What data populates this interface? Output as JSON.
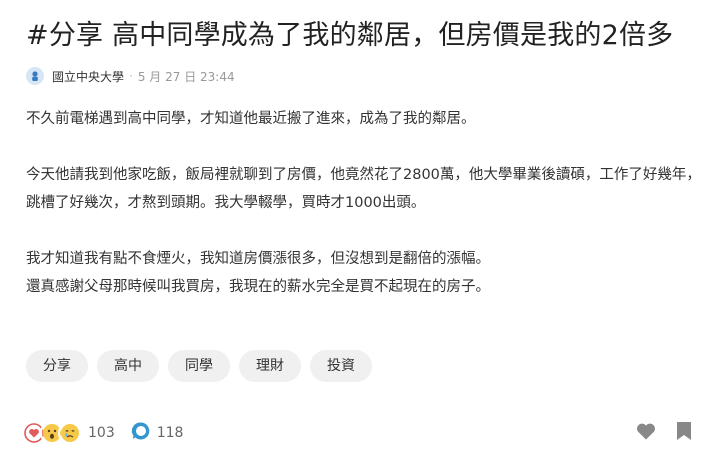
{
  "post": {
    "title": "#分享 高中同學成為了我的鄰居，但房價是我的2倍多",
    "author": "國立中央大學",
    "date": "5 月 27 日 23:44",
    "separator": "·",
    "paragraphs": [
      "不久前電梯遇到高中同學，才知道他最近搬了進來，成為了我的鄰居。",
      "今天他請我到他家吃飯，飯局裡就聊到了房價，他竟然花了2800萬，他大學畢業後讀碩，工作了好幾年，跳槽了好幾次，才熬到頭期。我大學輟學，買時才1000出頭。",
      "我才知道我有點不食煙火，我知道房價漲很多，但沒想到是翻倍的漲幅。",
      "還真感謝父母那時候叫我買房，我現在的薪水完全是買不起現在的房子。"
    ],
    "tags": [
      "分享",
      "高中",
      "同學",
      "理財",
      "投資"
    ]
  },
  "footer": {
    "reaction_count": "103",
    "comment_count": "118",
    "reaction_icons": [
      "heart-icon",
      "surprised-face-icon",
      "crying-face-icon"
    ]
  },
  "colors": {
    "heart": "#e05a5a",
    "surprised": "#f7c948",
    "comment": "#3397cf",
    "gray_icon": "#888888"
  }
}
